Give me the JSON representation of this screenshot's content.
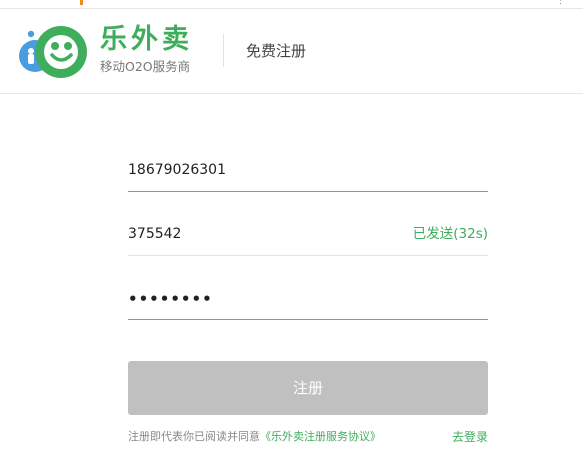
{
  "colors": {
    "brand_green": "#3fae5c",
    "input_active_line": "#5cb85c",
    "button_disabled": "#c0c0c0"
  },
  "header": {
    "brand_name": "乐外卖",
    "slogan": "移动O2O服务商",
    "page_title": "免费注册",
    "logo_icon": "smiley-logo-icon"
  },
  "form": {
    "phone": {
      "value": "18679026301"
    },
    "code": {
      "value": "375542",
      "status": "已发送(32s)"
    },
    "password": {
      "value": "••••••••"
    },
    "submit_label": "注册",
    "agreement_prefix": "注册即代表你已阅读并同意",
    "agreement_link": "《乐外卖注册服务协议》",
    "login_link": "去登录"
  }
}
